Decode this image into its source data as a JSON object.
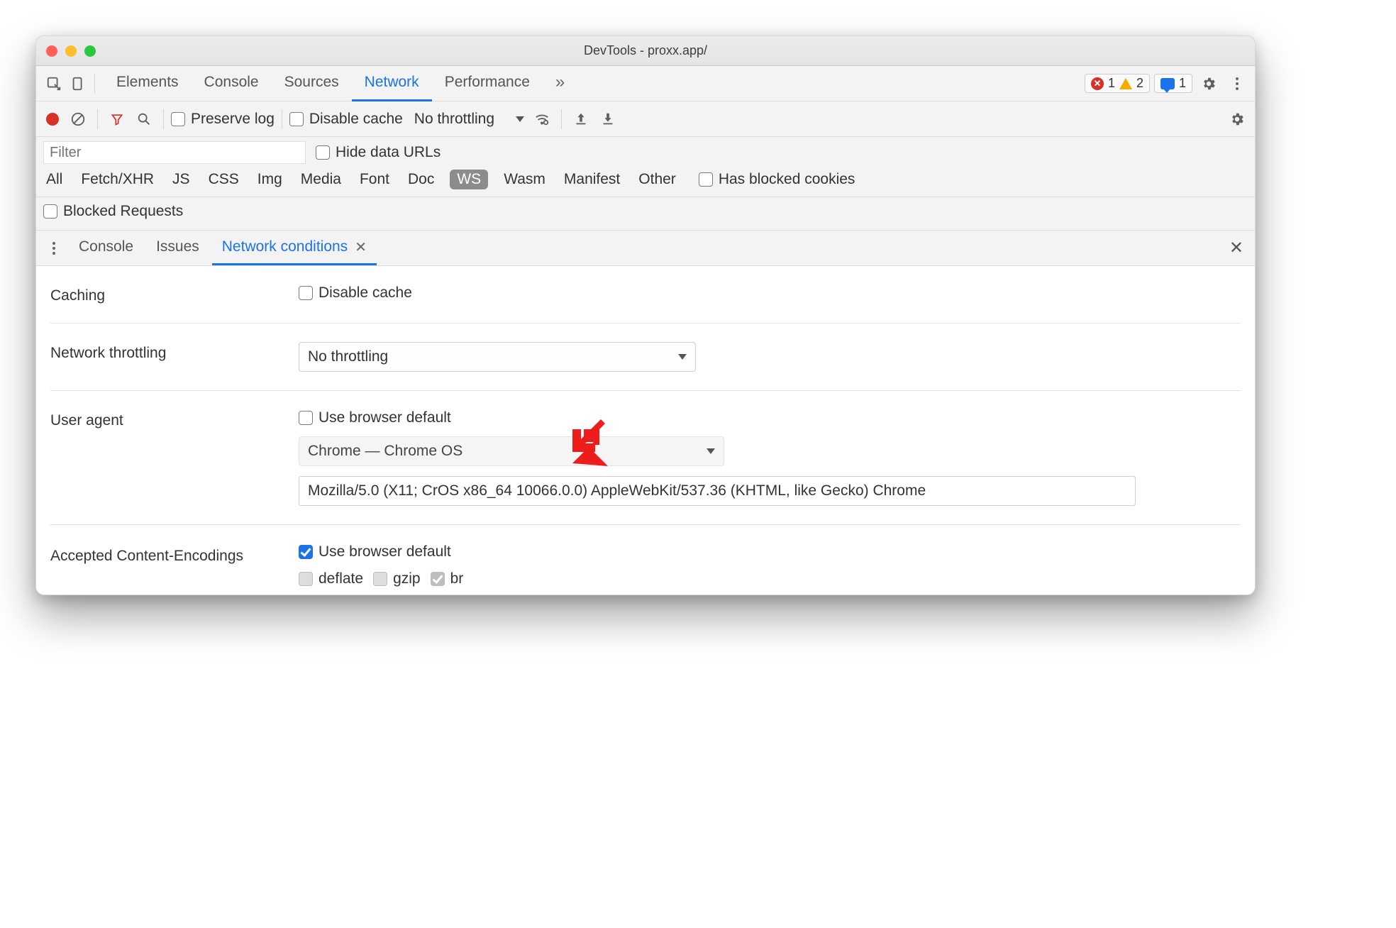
{
  "window": {
    "title": "DevTools - proxx.app/"
  },
  "status": {
    "errors": "1",
    "warnings": "2",
    "messages": "1"
  },
  "top_tabs": {
    "elements": "Elements",
    "console": "Console",
    "sources": "Sources",
    "network": "Network",
    "performance": "Performance"
  },
  "network_bar": {
    "preserve_log": "Preserve log",
    "disable_cache": "Disable cache",
    "throttling": "No throttling"
  },
  "filter": {
    "placeholder": "Filter",
    "hide_data_urls": "Hide data URLs"
  },
  "types": {
    "all": "All",
    "fetch": "Fetch/XHR",
    "js": "JS",
    "css": "CSS",
    "img": "Img",
    "media": "Media",
    "font": "Font",
    "doc": "Doc",
    "ws": "WS",
    "wasm": "Wasm",
    "manifest": "Manifest",
    "other": "Other",
    "has_blocked": "Has blocked cookies"
  },
  "blocked_requests": "Blocked Requests",
  "drawer": {
    "console": "Console",
    "issues": "Issues",
    "netcond": "Network conditions"
  },
  "netcond": {
    "caching_label": "Caching",
    "disable_cache": "Disable cache",
    "throttling_label": "Network throttling",
    "throttling_value": "No throttling",
    "ua_label": "User agent",
    "use_default": "Use browser default",
    "ua_select": "Chrome — Chrome OS",
    "ua_string": "Mozilla/5.0 (X11; CrOS x86_64 10066.0.0) AppleWebKit/537.36 (KHTML, like Gecko) Chrome",
    "enc_label": "Accepted Content-Encodings",
    "enc_default": "Use browser default",
    "enc_deflate": "deflate",
    "enc_gzip": "gzip",
    "enc_br": "br"
  }
}
